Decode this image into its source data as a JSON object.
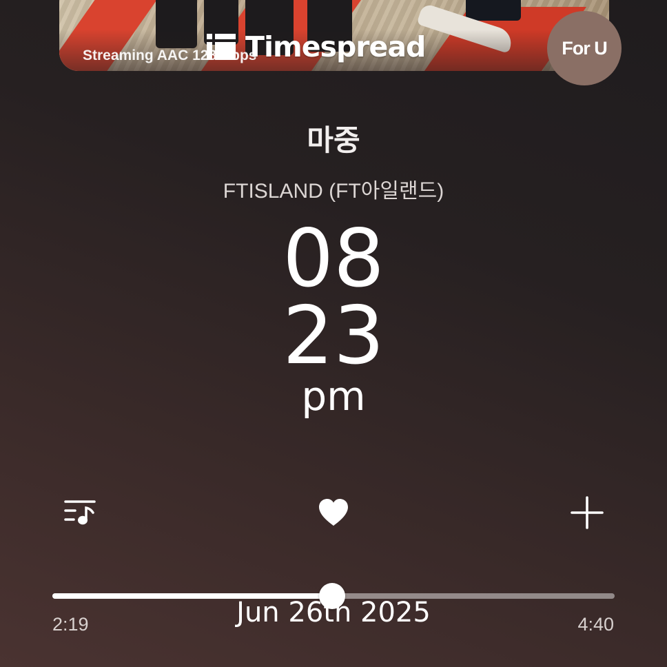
{
  "album": {
    "stream_info": "Streaming AAC 128 Kbps"
  },
  "brand": {
    "name": "Timespread",
    "icon": "timespread-logo-icon"
  },
  "for_u": {
    "label": "For U"
  },
  "track": {
    "title": "마중",
    "artist": "FTISLAND (FT아일랜드)"
  },
  "clock": {
    "hour": "08",
    "minute": "23",
    "ampm": "pm"
  },
  "actions": {
    "queue_icon": "playlist-music-icon",
    "like_icon": "heart-icon",
    "add_icon": "plus-icon"
  },
  "progress": {
    "elapsed": "2:19",
    "total": "4:40",
    "fraction": 0.497
  },
  "date": "Jun 26th 2025",
  "colors": {
    "background_top": "#1f1c1e",
    "background_bottom": "#4a3331",
    "for_u_button": "#8a6f65",
    "album_red": "#d9432f"
  }
}
